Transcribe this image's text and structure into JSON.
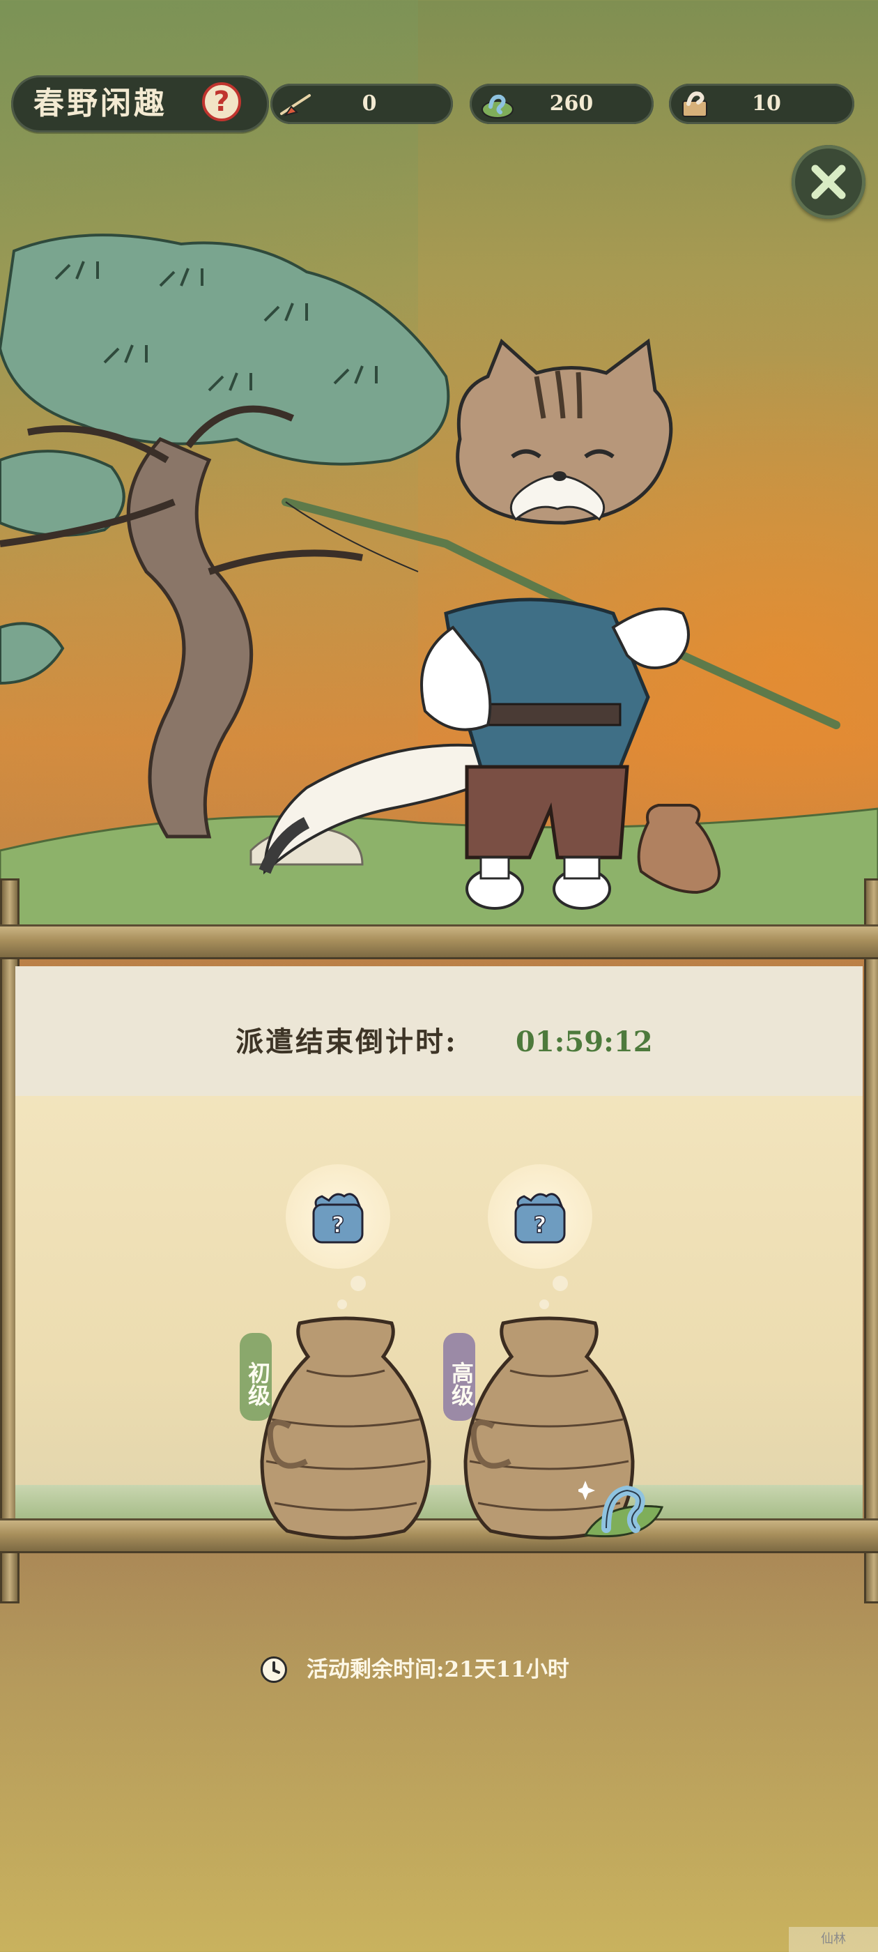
{
  "header": {
    "title": "春野闲趣",
    "help_glyph": "?",
    "resources": [
      {
        "icon": "fishing-rod-icon",
        "value": "0"
      },
      {
        "icon": "worm-bait-icon",
        "value": "260"
      },
      {
        "icon": "fishing-ticket-icon",
        "value": "10"
      }
    ],
    "close_icon": "close-x-icon"
  },
  "dispatch": {
    "countdown_label": "派遣结束倒计时:",
    "countdown_value": "01:59:12"
  },
  "baskets": [
    {
      "level": "初级",
      "tag_color": "#8aa86c",
      "reward_icon": "mystery-gift-bundle-icon",
      "reward_glyph": "?"
    },
    {
      "level": "高级",
      "tag_color": "#9b8aa6",
      "reward_icon": "mystery-gift-bundle-icon",
      "reward_glyph": "?"
    }
  ],
  "footer": {
    "remaining_time": "活动剩余时间:21天11小时",
    "clock_icon": "clock-icon"
  },
  "watermark": "仙林"
}
